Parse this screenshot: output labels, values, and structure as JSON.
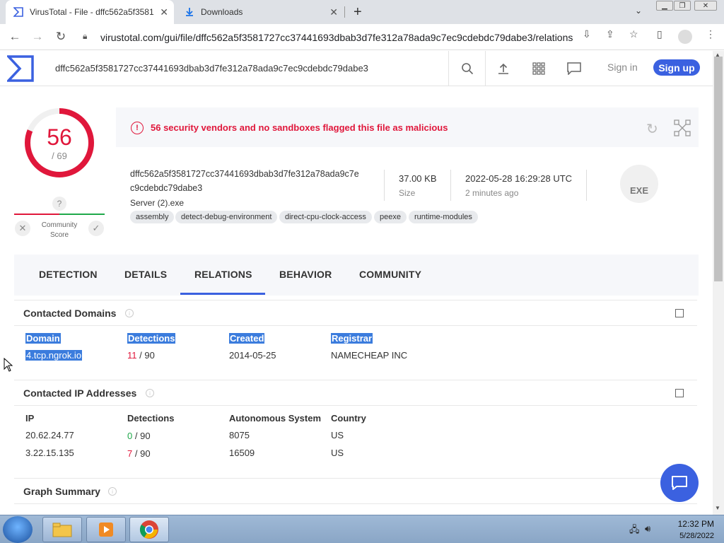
{
  "browser": {
    "tabs": [
      {
        "title": "VirusTotal - File - dffc562a5f3581",
        "active": true
      },
      {
        "title": "Downloads",
        "active": false
      }
    ],
    "new_tab_label": "+",
    "url": "virustotal.com/gui/file/dffc562a5f3581727cc37441693dbab3d7fe312a78ada9c7ec9cdebdc79dabe3/relations"
  },
  "vt": {
    "search_value": "dffc562a5f3581727cc37441693dbab3d7fe312a78ada9c7ec9cdebdc79dabe3",
    "sign_in": "Sign in",
    "sign_up": "Sign up",
    "score": {
      "detected": "56",
      "total": "/ 69",
      "detected_num": 56,
      "total_num": 69
    },
    "community": {
      "question": "?",
      "label_line1": "Community",
      "label_line2": "Score"
    },
    "alert": "56 security vendors and no sandboxes flagged this file as malicious",
    "file": {
      "hash_line1": "dffc562a5f3581727cc37441693dbab3d7fe312a78ada9c7e",
      "hash_line2": "c9cdebdc79dabe3",
      "name": "Server (2).exe",
      "tags": [
        "assembly",
        "detect-debug-environment",
        "direct-cpu-clock-access",
        "peexe",
        "runtime-modules"
      ],
      "size_value": "37.00 KB",
      "size_label": "Size",
      "date_value": "2022-05-28 16:29:28 UTC",
      "date_label": "2 minutes ago",
      "type_badge": "EXE"
    },
    "tabs": [
      "DETECTION",
      "DETAILS",
      "RELATIONS",
      "BEHAVIOR",
      "COMMUNITY"
    ],
    "active_tab": "RELATIONS",
    "contacted_domains": {
      "title": "Contacted Domains",
      "columns": [
        "Domain",
        "Detections",
        "Created",
        "Registrar"
      ],
      "rows": [
        {
          "domain": "4.tcp.ngrok.io",
          "det": "11",
          "det_total": "/ 90",
          "created": "2014-05-25",
          "registrar": "NAMECHEAP INC"
        }
      ]
    },
    "contacted_ips": {
      "title": "Contacted IP Addresses",
      "columns": [
        "IP",
        "Detections",
        "Autonomous System",
        "Country"
      ],
      "rows": [
        {
          "ip": "20.62.24.77",
          "det": "0",
          "det_total": "/ 90",
          "as": "8075",
          "country": "US"
        },
        {
          "ip": "3.22.15.135",
          "det": "7",
          "det_total": "/ 90",
          "as": "16509",
          "country": "US"
        }
      ]
    },
    "graph_summary": {
      "title": "Graph Summary"
    }
  },
  "taskbar": {
    "time": "12:32 PM",
    "date": "5/28/2022"
  },
  "colors": {
    "accent": "#3b61e0",
    "malicious": "#e0173b",
    "clean": "#1fa84a"
  }
}
